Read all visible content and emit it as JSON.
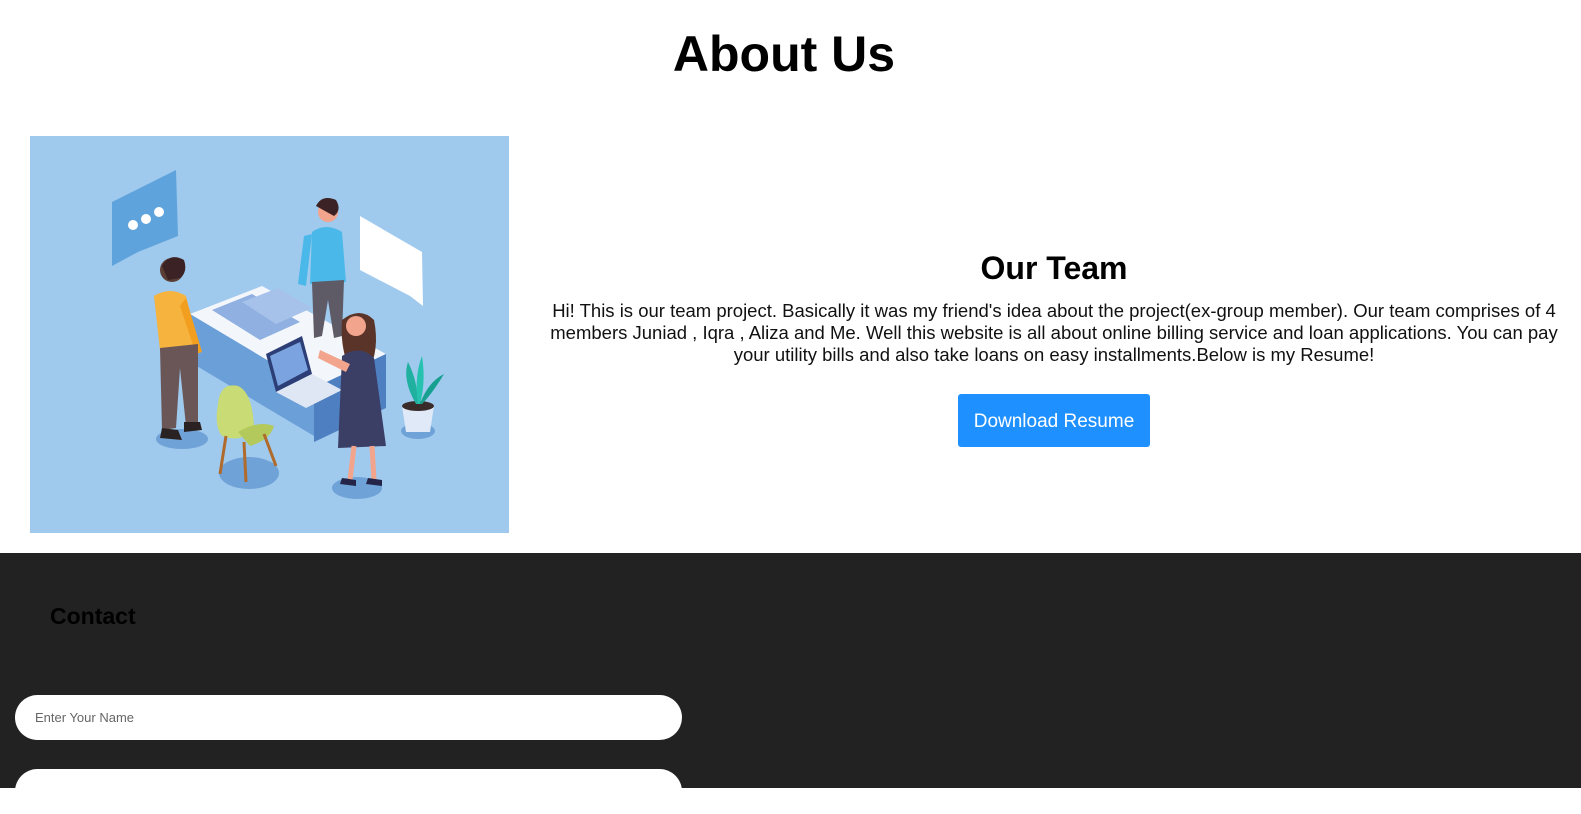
{
  "page": {
    "title": "About Us"
  },
  "hero": {
    "image_alt": "team illustration"
  },
  "team": {
    "heading": "Our Team",
    "text": "Hi! This is our team project. Basically it was my friend's idea about the project(ex-group member). Our team comprises of 4 members Juniad , Iqra , Aliza and Me. Well this website is all about online billing service and loan applications. You can pay your utility bills and also take loans on easy installments.Below is my Resume!",
    "button_label": "Download Resume"
  },
  "footer": {
    "contact_heading": "Contact",
    "name_placeholder": "Enter Your Name",
    "second_placeholder": ""
  },
  "colors": {
    "accent": "#1e90ff",
    "footer_bg": "#222222",
    "hero_bg": "#a0c9ee"
  }
}
